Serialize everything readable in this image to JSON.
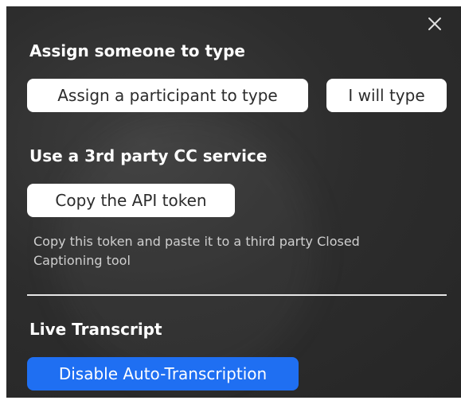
{
  "sections": {
    "assign": {
      "heading": "Assign someone to type",
      "assign_participant_label": "Assign a participant to type",
      "self_type_label": "I will type"
    },
    "third_party": {
      "heading": "Use a 3rd party CC service",
      "copy_token_label": "Copy the API token",
      "description": "Copy this token and paste it to a third party Closed Captioning tool"
    },
    "transcript": {
      "heading": "Live Transcript",
      "disable_label": "Disable Auto-Transcription"
    }
  },
  "icons": {
    "close": "close-icon"
  },
  "colors": {
    "panel_bg": "#2d2d2d",
    "primary_button": "#1f6ff2",
    "secondary_button": "#ffffff"
  }
}
